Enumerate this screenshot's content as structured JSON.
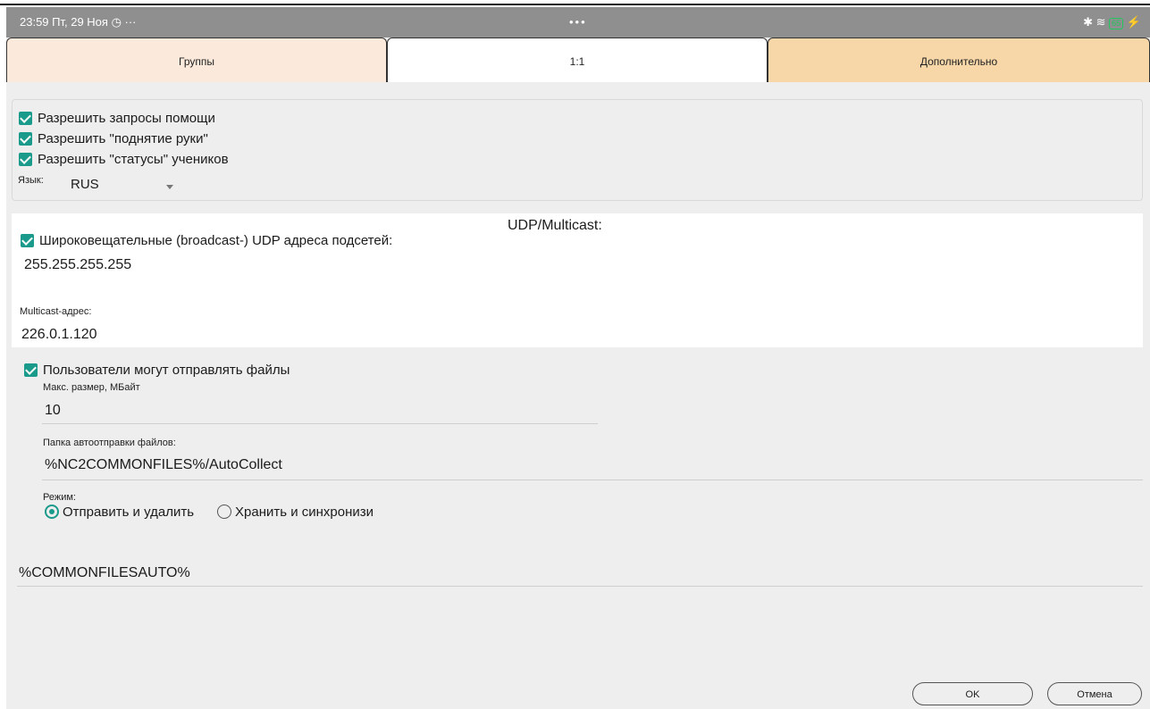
{
  "status_bar": {
    "time_date": "23:59  Пт, 29 Ноя  ◷ ···",
    "center_dots": "•••",
    "icons": "✱ ≋",
    "battery": "65",
    "charging": "⚡"
  },
  "tabs": [
    {
      "label": "Группы"
    },
    {
      "label": "1:1"
    },
    {
      "label": "Дополнительно"
    }
  ],
  "general": {
    "allow_help": "Разрешить запросы помощи",
    "allow_hand": "Разрешить \"поднятие руки\"",
    "allow_status": "Разрешить \"статусы\" учеников",
    "language_label": "Язык:",
    "language_value": "RUS"
  },
  "udp": {
    "title": "UDP/Multicast:",
    "broadcast_label": "Широковещательные (broadcast-) UDP адреса подсетей:",
    "broadcast_value": "255.255.255.255",
    "multicast_label": "Multicast-адрес:",
    "multicast_value": "226.0.1.120"
  },
  "files": {
    "allow_send": "Пользователи могут отправлять файлы",
    "max_size_label": "Макс. размер, МБайт",
    "max_size_value": "10",
    "folder_label": "Папка автоотправки файлов:",
    "folder_value": "%NC2COMMONFILES%/AutoCollect",
    "mode_label": "Режим:",
    "mode_send": "Отправить и удалить",
    "mode_keep": "Хранить и синхронизи",
    "common_value": "%COMMONFILESAUTO%"
  },
  "buttons": {
    "ok": "OK",
    "cancel": "Отмена"
  },
  "colors": {
    "accent": "#1a9a8a",
    "tab_active": "#f7d6a8",
    "tab_inactive": "#fbeadb"
  }
}
